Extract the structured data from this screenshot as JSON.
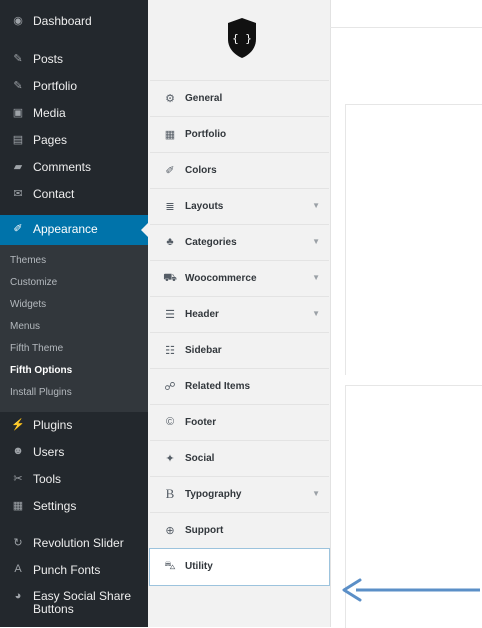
{
  "wp_menu": {
    "items_top": [
      {
        "label": "Dashboard",
        "icon": "dashboard-icon",
        "glyph": "◉"
      },
      {
        "label": "Posts",
        "icon": "pin-icon",
        "glyph": "✎"
      },
      {
        "label": "Portfolio",
        "icon": "pin-icon",
        "glyph": "✎"
      },
      {
        "label": "Media",
        "icon": "media-icon",
        "glyph": "▣"
      },
      {
        "label": "Pages",
        "icon": "pages-icon",
        "glyph": "▤"
      },
      {
        "label": "Comments",
        "icon": "comments-icon",
        "glyph": "▰"
      },
      {
        "label": "Contact",
        "icon": "mail-icon",
        "glyph": "✉"
      }
    ],
    "active": {
      "label": "Appearance",
      "icon": "brush-icon",
      "glyph": "✐"
    },
    "submenu": [
      "Themes",
      "Customize",
      "Widgets",
      "Menus",
      "Fifth Theme",
      "Fifth Options",
      "Install Plugins"
    ],
    "submenu_current": "Fifth Options",
    "items_bottom": [
      {
        "label": "Plugins",
        "icon": "plug-icon",
        "glyph": "⚡"
      },
      {
        "label": "Users",
        "icon": "users-icon",
        "glyph": "☻"
      },
      {
        "label": "Tools",
        "icon": "wrench-icon",
        "glyph": "✂"
      },
      {
        "label": "Settings",
        "icon": "settings-icon",
        "glyph": "▦"
      },
      {
        "label": "Revolution Slider",
        "icon": "refresh-icon",
        "glyph": "↻"
      },
      {
        "label": "Punch Fonts",
        "icon": "font-a-icon",
        "glyph": "A"
      },
      {
        "label": "Easy Social Share Buttons",
        "icon": "share-icon",
        "glyph": "◕"
      }
    ]
  },
  "options_menu": {
    "logo_text": "{ }",
    "items": [
      {
        "label": "General",
        "icon": "gears-icon",
        "glyph": "⚙",
        "has_submenu": false
      },
      {
        "label": "Portfolio",
        "icon": "grid-icon",
        "glyph": "▦",
        "has_submenu": false
      },
      {
        "label": "Colors",
        "icon": "brush-icon",
        "glyph": "✐",
        "has_submenu": false
      },
      {
        "label": "Layouts",
        "icon": "align-icon",
        "glyph": "≣",
        "has_submenu": true
      },
      {
        "label": "Categories",
        "icon": "sitemap-icon",
        "glyph": "♣",
        "has_submenu": true
      },
      {
        "label": "Woocommerce",
        "icon": "cart-icon",
        "glyph": "⛟",
        "has_submenu": true
      },
      {
        "label": "Header",
        "icon": "header-icon",
        "glyph": "☰",
        "has_submenu": true
      },
      {
        "label": "Sidebar",
        "icon": "list-icon",
        "glyph": "☷",
        "has_submenu": false
      },
      {
        "label": "Related Items",
        "icon": "chain-icon",
        "glyph": "☍",
        "has_submenu": false
      },
      {
        "label": "Footer",
        "icon": "copyright-icon",
        "glyph": "©",
        "has_submenu": false
      },
      {
        "label": "Social",
        "icon": "twitter-icon",
        "glyph": "✦",
        "has_submenu": false
      },
      {
        "label": "Typography",
        "icon": "typography-icon",
        "glyph": "B",
        "has_submenu": true
      },
      {
        "label": "Support",
        "icon": "lifebuoy-icon",
        "glyph": "⊕",
        "has_submenu": false
      },
      {
        "label": "Utility",
        "icon": "truck-icon",
        "glyph": "⛍",
        "has_submenu": false
      }
    ],
    "highlighted": "Utility",
    "chevron_glyph": "▼"
  },
  "annotation": {
    "arrow_color": "#5b8fc7"
  },
  "colors": {
    "sidebar_bg": "#23282d",
    "active_bg": "#0073aa",
    "submenu_bg": "#32373c",
    "panel_bg": "#f2f2f2"
  }
}
